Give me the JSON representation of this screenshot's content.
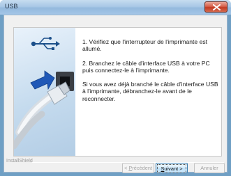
{
  "window": {
    "title": "USB",
    "close_label": "Close"
  },
  "instructions": [
    "1. Vérifiez que l'interrupteur de l'imprimante est allumé.",
    "2. Branchez le câble d'interface USB à votre PC puis connectez-le à l'imprimante.",
    "Si vous avez déjà branché le câble d'interface USB à l'imprimante, débranchez-le avant de le reconnecter."
  ],
  "brand": "InstallShield",
  "buttons": {
    "back": {
      "label": "< Précédent",
      "mnemonic_char": "P",
      "prefix": "< ",
      "rest": "récédent"
    },
    "next": {
      "label": "Suivant >",
      "mnemonic_char": "S",
      "rest": "uivant >"
    },
    "cancel": {
      "label": "Annuler"
    }
  },
  "colors": {
    "usb_icon": "#1b4f8a",
    "arrow": "#1f58b7",
    "title_close": "#c9452e"
  },
  "icons": [
    "usb-icon",
    "blue-arrow-icon",
    "usb-cable-icon",
    "close-icon"
  ]
}
